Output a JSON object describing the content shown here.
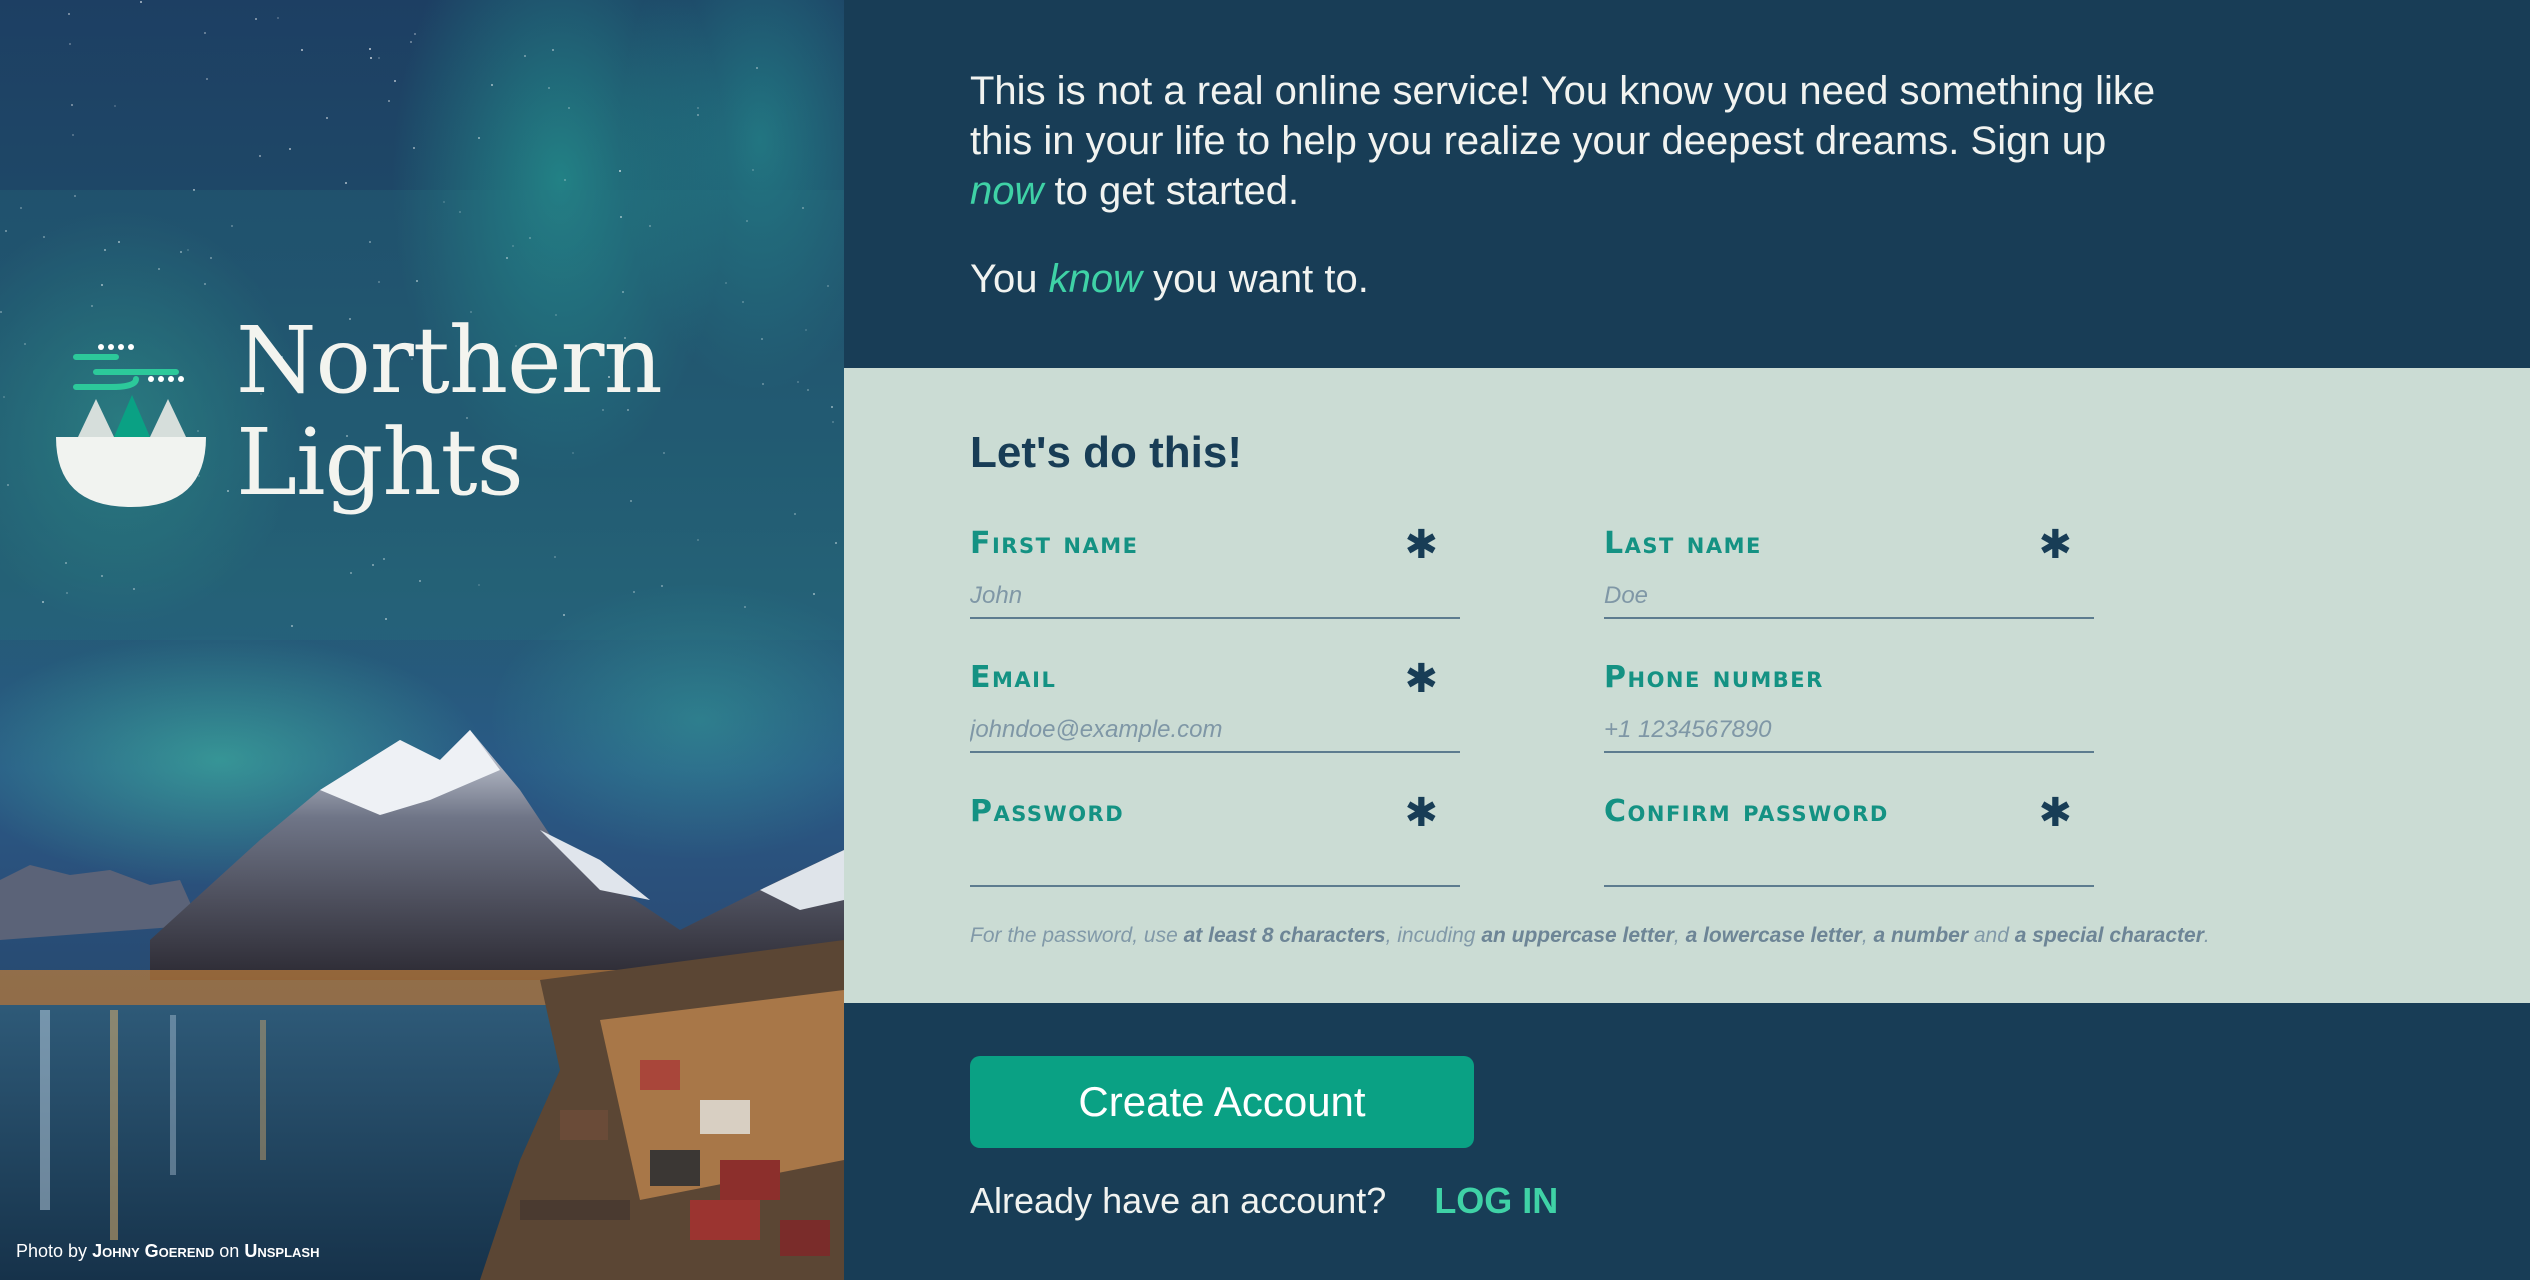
{
  "brand": {
    "title_line1": "Northern",
    "title_line2": "Lights",
    "logo_icon": "northern-lights-logo-icon"
  },
  "credit": {
    "prefix": "Photo by",
    "photographer": "Johny Goerend",
    "middle": "on",
    "source": "Unsplash"
  },
  "intro": {
    "para1_part1": "This is not a real online service! You know you need something like this in your life to help you realize your deepest dreams. Sign up ",
    "para1_em": "now",
    "para1_part2": " to get started.",
    "para2_part1": "You ",
    "para2_em": "know",
    "para2_part2": " you want to."
  },
  "form": {
    "title": "Let's do this!",
    "required_mark": "✱",
    "fields": [
      {
        "label": "First name",
        "placeholder": "John",
        "required": true
      },
      {
        "label": "Last name",
        "placeholder": "Doe",
        "required": true
      },
      {
        "label": "Email",
        "placeholder": "johndoe@example.com",
        "required": true
      },
      {
        "label": "Phone number",
        "placeholder": "+1 1234567890",
        "required": false
      },
      {
        "label": "Password",
        "placeholder": "",
        "required": true
      },
      {
        "label": "Confirm password",
        "placeholder": "",
        "required": true
      }
    ],
    "hint": {
      "t1": "For the password, use ",
      "b1": "at least 8 characters",
      "t2": ", incuding ",
      "b2": "an uppercase letter",
      "t3": ", ",
      "b3": "a lowercase letter",
      "t4": ", ",
      "b4": "a number",
      "t5": " and ",
      "b5": "a special character",
      "t6": "."
    }
  },
  "actions": {
    "create_account": "Create Account",
    "already_text": "Already have an account?",
    "login_link": "LOG IN"
  },
  "colors": {
    "navy": "#183d56",
    "mint_bg": "#cbdcd4",
    "teal": "#0aa184",
    "accent_green": "#3fd2a6",
    "label_teal": "#149283"
  }
}
